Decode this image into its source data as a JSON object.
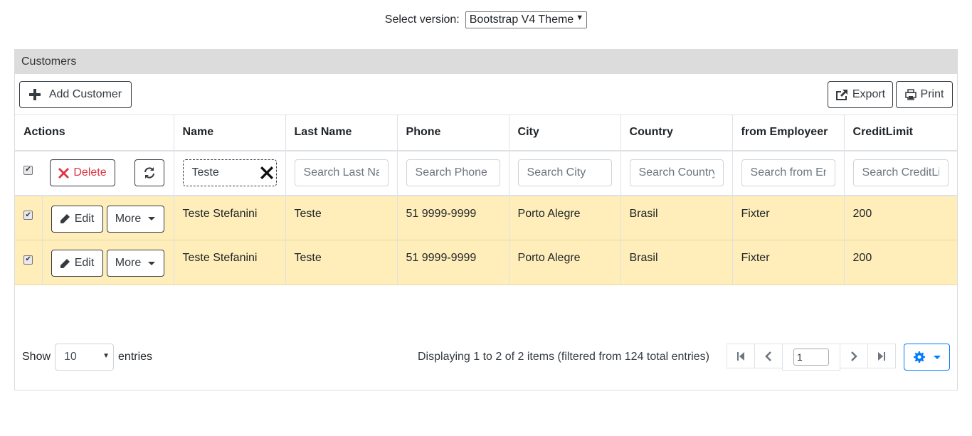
{
  "version": {
    "label": "Select version:",
    "selected": "Bootstrap V4 Theme"
  },
  "panel": {
    "title": "Customers"
  },
  "toolbar": {
    "add_label": "Add Customer",
    "export_label": "Export",
    "print_label": "Print"
  },
  "columns": [
    "Actions",
    "Name",
    "Last Name",
    "Phone",
    "City",
    "Country",
    "from Employeer",
    "CreditLimit"
  ],
  "filters": {
    "delete_label": "Delete",
    "name_value": "Teste",
    "last_name_placeholder": "Search Last Name",
    "phone_placeholder": "Search Phone",
    "city_placeholder": "Search City",
    "country_placeholder": "Search Country",
    "employeer_placeholder": "Search from Employeer",
    "credit_placeholder": "Search CreditLimit"
  },
  "row_actions": {
    "edit_label": "Edit",
    "more_label": "More"
  },
  "rows": [
    {
      "name": "Teste Stefanini",
      "last_name": "Teste",
      "phone": "51 9999-9999",
      "city": "Porto Alegre",
      "country": "Brasil",
      "employeer": "Fixter",
      "credit": "200"
    },
    {
      "name": "Teste Stefanini",
      "last_name": "Teste",
      "phone": "51 9999-9999",
      "city": "Porto Alegre",
      "country": "Brasil",
      "employeer": "Fixter",
      "credit": "200"
    }
  ],
  "footer": {
    "show_label": "Show",
    "page_size": "10",
    "entries_label": "entries",
    "display_info": "Displaying 1 to 2 of 2 items (filtered from 124 total entries)",
    "current_page": "1"
  },
  "icons": {
    "add": "plus-icon",
    "export": "export-icon",
    "print": "printer-icon",
    "delete": "x-icon",
    "refresh": "refresh-icon",
    "clear": "x-icon",
    "edit": "pencil-icon",
    "settings": "gear-icon"
  },
  "colors": {
    "selected_row": "#ffeeba",
    "delete": "#dc3545",
    "primary": "#007bff",
    "header_bg": "#dcdcdc"
  }
}
